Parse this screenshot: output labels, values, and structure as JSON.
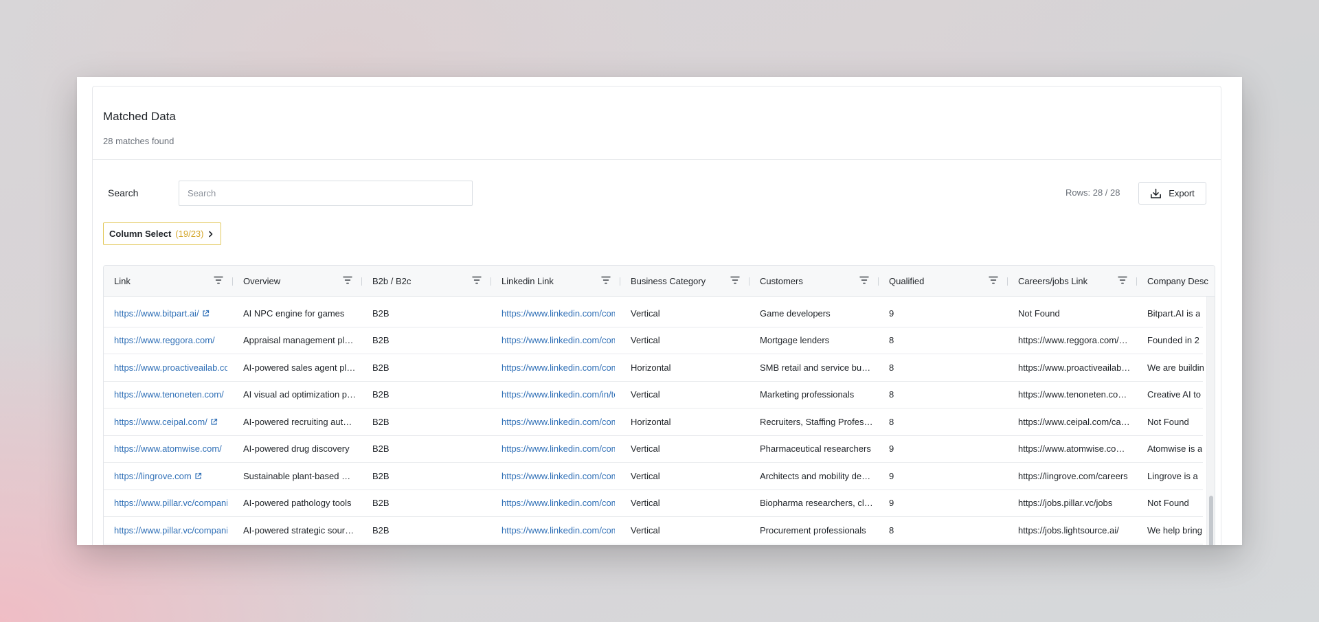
{
  "header": {
    "title": "Matched Data",
    "subtitle": "28 matches found"
  },
  "toolbar": {
    "search_label": "Search",
    "search_placeholder": "Search",
    "search_value": "",
    "rows_label": "Rows: 28 / 28",
    "export_label": "Export",
    "column_select_label": "Column Select",
    "column_select_count": "(19/23)"
  },
  "table": {
    "columns": [
      "Link",
      "Overview",
      "B2b / B2c",
      "Linkedin Link",
      "Business Category",
      "Customers",
      "Qualified",
      "Careers/jobs Link",
      "Company Desc"
    ],
    "rows": [
      [
        "https://www.bitpart.ai/",
        "AI NPC engine for games",
        "B2B",
        "https://www.linkedin.com/company/bitpart",
        "Vertical",
        "Game developers",
        "9",
        "Not Found",
        "Bitpart.AI is a"
      ],
      [
        "https://www.reggora.com/",
        "Appraisal management platform",
        "B2B",
        "https://www.linkedin.com/company/reggora",
        "Vertical",
        "Mortgage lenders",
        "8",
        "https://www.reggora.com/careers",
        "Founded in 2"
      ],
      [
        "https://www.proactiveailab.com/",
        "AI-powered sales agent platform",
        "B2B",
        "https://www.linkedin.com/company/proactive",
        "Horizontal",
        "SMB retail and service businesses",
        "8",
        "https://www.proactiveailab.com/careers",
        "We are buildin"
      ],
      [
        "https://www.tenoneten.com/",
        "AI visual ad optimization platform",
        "B2B",
        "https://www.linkedin.com/in/tenoneten",
        "Vertical",
        "Marketing professionals",
        "8",
        "https://www.tenoneten.com/careers",
        "Creative AI to"
      ],
      [
        "https://www.ceipal.com/",
        "AI-powered recruiting automation",
        "B2B",
        "https://www.linkedin.com/company/ceipal",
        "Horizontal",
        "Recruiters, Staffing Professionals",
        "8",
        "https://www.ceipal.com/careers",
        "Not Found"
      ],
      [
        "https://www.atomwise.com/",
        "AI-powered drug discovery",
        "B2B",
        "https://www.linkedin.com/company/atomwise",
        "Vertical",
        "Pharmaceutical researchers",
        "9",
        "https://www.atomwise.com/careers",
        "Atomwise is a"
      ],
      [
        "https://lingrove.com",
        "Sustainable plant-based materials",
        "B2B",
        "https://www.linkedin.com/company/lingrove",
        "Vertical",
        "Architects and mobility designers",
        "9",
        "https://lingrove.com/careers",
        "Lingrove is a"
      ],
      [
        "https://www.pillar.vc/companies",
        "AI-powered pathology tools",
        "B2B",
        "https://www.linkedin.com/company/pillar",
        "Vertical",
        "Biopharma researchers, clinicians",
        "9",
        "https://jobs.pillar.vc/jobs",
        "Not Found"
      ],
      [
        "https://www.pillar.vc/companies",
        "AI-powered strategic sourcing",
        "B2B",
        "https://www.linkedin.com/company/lightsource",
        "Vertical",
        "Procurement professionals",
        "8",
        "https://jobs.lightsource.ai/",
        "We help bring"
      ]
    ]
  },
  "colors": {
    "link": "#2f6fb6",
    "accent": "#d4a72c",
    "border": "#e2e5e9"
  },
  "icons": [
    "filter-icon",
    "external-link-icon",
    "download-icon",
    "chevron-right-icon"
  ]
}
